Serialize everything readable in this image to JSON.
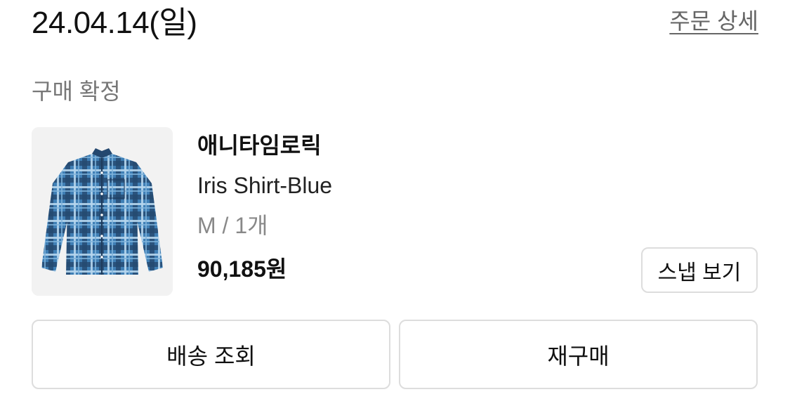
{
  "order": {
    "date": "24.04.14(일)",
    "detail_link": "주문 상세",
    "status": "구매 확정"
  },
  "product": {
    "image_icon": "plaid-shirt-image",
    "brand": "애니타임로릭",
    "name": "Iris Shirt-Blue",
    "option": "M / 1개",
    "price": "90,185원",
    "snap_button": "스냅 보기"
  },
  "actions": {
    "tracking": "배송 조회",
    "reorder": "재구매"
  }
}
